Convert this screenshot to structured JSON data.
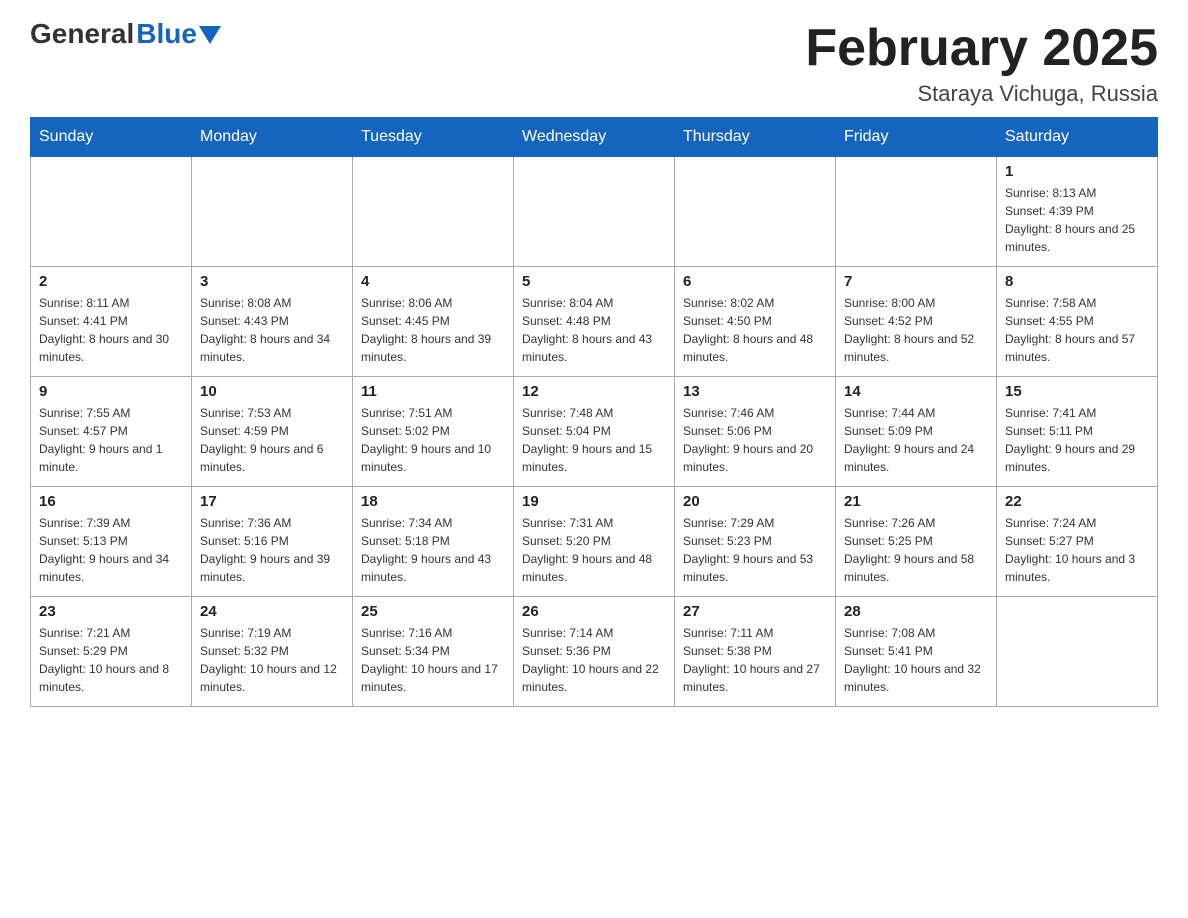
{
  "header": {
    "logo_main": "General",
    "logo_blue": "Blue",
    "month_title": "February 2025",
    "location": "Staraya Vichuga, Russia"
  },
  "days_of_week": [
    "Sunday",
    "Monday",
    "Tuesday",
    "Wednesday",
    "Thursday",
    "Friday",
    "Saturday"
  ],
  "weeks": [
    [
      {
        "day": "",
        "info": ""
      },
      {
        "day": "",
        "info": ""
      },
      {
        "day": "",
        "info": ""
      },
      {
        "day": "",
        "info": ""
      },
      {
        "day": "",
        "info": ""
      },
      {
        "day": "",
        "info": ""
      },
      {
        "day": "1",
        "info": "Sunrise: 8:13 AM\nSunset: 4:39 PM\nDaylight: 8 hours and 25 minutes."
      }
    ],
    [
      {
        "day": "2",
        "info": "Sunrise: 8:11 AM\nSunset: 4:41 PM\nDaylight: 8 hours and 30 minutes."
      },
      {
        "day": "3",
        "info": "Sunrise: 8:08 AM\nSunset: 4:43 PM\nDaylight: 8 hours and 34 minutes."
      },
      {
        "day": "4",
        "info": "Sunrise: 8:06 AM\nSunset: 4:45 PM\nDaylight: 8 hours and 39 minutes."
      },
      {
        "day": "5",
        "info": "Sunrise: 8:04 AM\nSunset: 4:48 PM\nDaylight: 8 hours and 43 minutes."
      },
      {
        "day": "6",
        "info": "Sunrise: 8:02 AM\nSunset: 4:50 PM\nDaylight: 8 hours and 48 minutes."
      },
      {
        "day": "7",
        "info": "Sunrise: 8:00 AM\nSunset: 4:52 PM\nDaylight: 8 hours and 52 minutes."
      },
      {
        "day": "8",
        "info": "Sunrise: 7:58 AM\nSunset: 4:55 PM\nDaylight: 8 hours and 57 minutes."
      }
    ],
    [
      {
        "day": "9",
        "info": "Sunrise: 7:55 AM\nSunset: 4:57 PM\nDaylight: 9 hours and 1 minute."
      },
      {
        "day": "10",
        "info": "Sunrise: 7:53 AM\nSunset: 4:59 PM\nDaylight: 9 hours and 6 minutes."
      },
      {
        "day": "11",
        "info": "Sunrise: 7:51 AM\nSunset: 5:02 PM\nDaylight: 9 hours and 10 minutes."
      },
      {
        "day": "12",
        "info": "Sunrise: 7:48 AM\nSunset: 5:04 PM\nDaylight: 9 hours and 15 minutes."
      },
      {
        "day": "13",
        "info": "Sunrise: 7:46 AM\nSunset: 5:06 PM\nDaylight: 9 hours and 20 minutes."
      },
      {
        "day": "14",
        "info": "Sunrise: 7:44 AM\nSunset: 5:09 PM\nDaylight: 9 hours and 24 minutes."
      },
      {
        "day": "15",
        "info": "Sunrise: 7:41 AM\nSunset: 5:11 PM\nDaylight: 9 hours and 29 minutes."
      }
    ],
    [
      {
        "day": "16",
        "info": "Sunrise: 7:39 AM\nSunset: 5:13 PM\nDaylight: 9 hours and 34 minutes."
      },
      {
        "day": "17",
        "info": "Sunrise: 7:36 AM\nSunset: 5:16 PM\nDaylight: 9 hours and 39 minutes."
      },
      {
        "day": "18",
        "info": "Sunrise: 7:34 AM\nSunset: 5:18 PM\nDaylight: 9 hours and 43 minutes."
      },
      {
        "day": "19",
        "info": "Sunrise: 7:31 AM\nSunset: 5:20 PM\nDaylight: 9 hours and 48 minutes."
      },
      {
        "day": "20",
        "info": "Sunrise: 7:29 AM\nSunset: 5:23 PM\nDaylight: 9 hours and 53 minutes."
      },
      {
        "day": "21",
        "info": "Sunrise: 7:26 AM\nSunset: 5:25 PM\nDaylight: 9 hours and 58 minutes."
      },
      {
        "day": "22",
        "info": "Sunrise: 7:24 AM\nSunset: 5:27 PM\nDaylight: 10 hours and 3 minutes."
      }
    ],
    [
      {
        "day": "23",
        "info": "Sunrise: 7:21 AM\nSunset: 5:29 PM\nDaylight: 10 hours and 8 minutes."
      },
      {
        "day": "24",
        "info": "Sunrise: 7:19 AM\nSunset: 5:32 PM\nDaylight: 10 hours and 12 minutes."
      },
      {
        "day": "25",
        "info": "Sunrise: 7:16 AM\nSunset: 5:34 PM\nDaylight: 10 hours and 17 minutes."
      },
      {
        "day": "26",
        "info": "Sunrise: 7:14 AM\nSunset: 5:36 PM\nDaylight: 10 hours and 22 minutes."
      },
      {
        "day": "27",
        "info": "Sunrise: 7:11 AM\nSunset: 5:38 PM\nDaylight: 10 hours and 27 minutes."
      },
      {
        "day": "28",
        "info": "Sunrise: 7:08 AM\nSunset: 5:41 PM\nDaylight: 10 hours and 32 minutes."
      },
      {
        "day": "",
        "info": ""
      }
    ]
  ]
}
